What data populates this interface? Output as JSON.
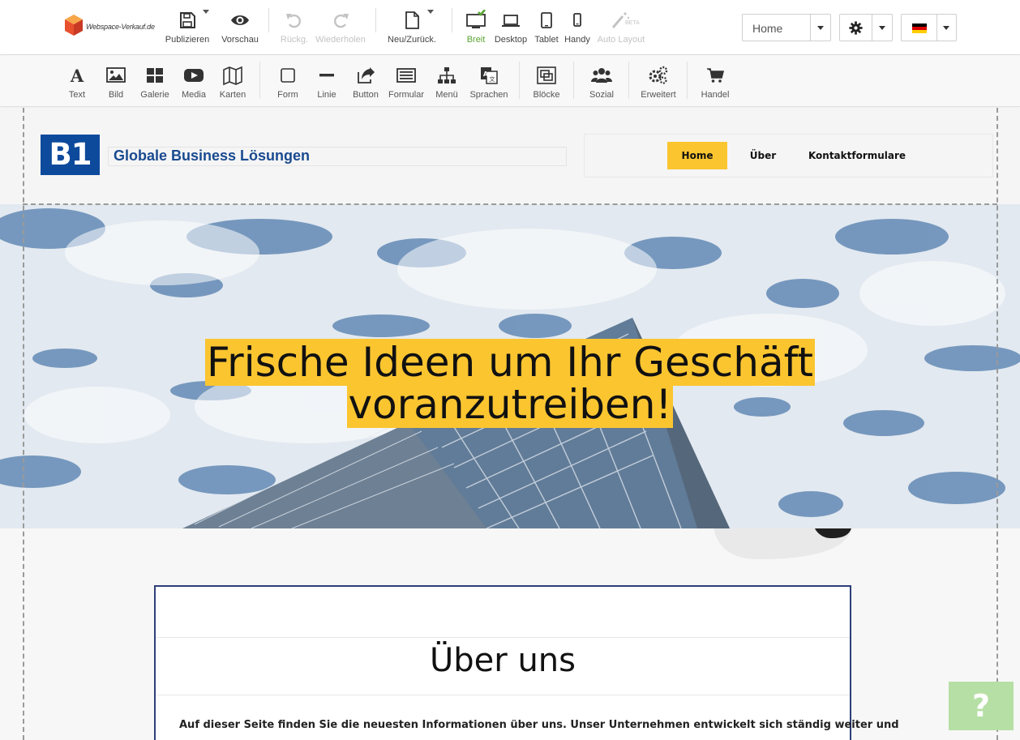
{
  "app": {
    "logo_text": "Webspace-Verkauf.de"
  },
  "toolbar": {
    "publish": "Publizieren",
    "preview": "Vorschau",
    "undo": "Rückg.",
    "redo": "Wiederholen",
    "new_back": "Neu/Zurück.",
    "wide": "Breit",
    "desktop": "Desktop",
    "tablet": "Tablet",
    "mobile": "Handy",
    "auto_layout": "Auto Layout",
    "beta_badge": "BETA",
    "page_select_value": "Home"
  },
  "elements": {
    "text": "Text",
    "image": "Bild",
    "gallery": "Galerie",
    "media": "Media",
    "maps": "Karten",
    "shape": "Form",
    "line": "Linie",
    "button": "Button",
    "form": "Formular",
    "menu": "Menü",
    "languages": "Sprachen",
    "blocks": "Blöcke",
    "social": "Sozial",
    "advanced": "Erweitert",
    "commerce": "Handel"
  },
  "site": {
    "logo_mark": "B1",
    "title": "Globale Business Lösungen",
    "nav": [
      "Home",
      "Über",
      "Kontaktformulare"
    ],
    "hero_line1": "Frische Ideen um Ihr Geschäft",
    "hero_line2": "voranzutreiben!",
    "about_title": "Über uns",
    "about_text": "Auf dieser Seite finden Sie die neuesten Informationen über uns. Unser Unternehmen entwickelt sich ständig weiter und"
  },
  "help": {
    "label": "?"
  },
  "colors": {
    "accent_yellow": "#fbc530",
    "brand_blue": "#0e4a9c",
    "active_green": "#5aa632",
    "help_green": "#b5dfa4"
  },
  "icons": {
    "publish": "save-icon",
    "preview": "eye-icon",
    "undo": "undo-icon",
    "redo": "redo-icon",
    "new_back": "file-icon",
    "wide": "monitor-icon",
    "desktop": "laptop-icon",
    "tablet": "tablet-icon",
    "mobile": "phone-icon",
    "auto_layout": "magic-wand-icon",
    "settings": "gear-icon",
    "language": "german-flag-icon"
  }
}
